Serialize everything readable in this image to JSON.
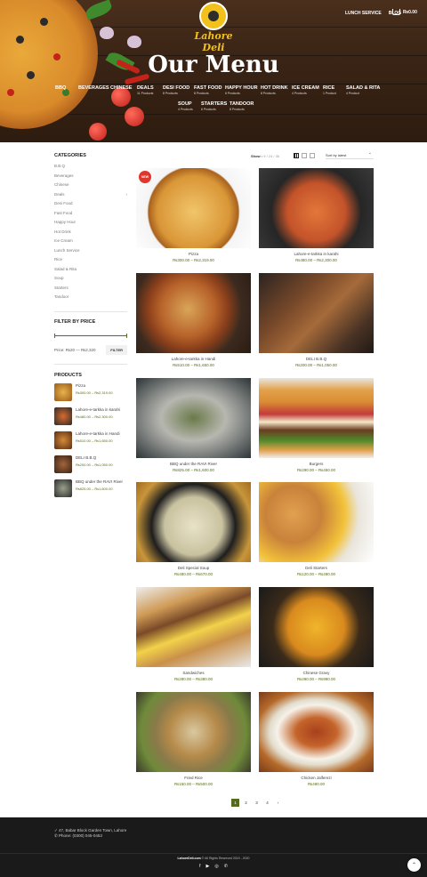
{
  "header": {
    "logo_text": "Lahore Deli",
    "nav": [
      "LUNCH SERVICE",
      "BLOG"
    ],
    "cart_total": "₨0.00",
    "page_title": "Our Menu",
    "categories": [
      {
        "label": "BBQ",
        "count": ""
      },
      {
        "label": "BEVERAGES",
        "count": ""
      },
      {
        "label": "CHINESE",
        "count": ""
      },
      {
        "label": "DEALS",
        "count": "11 Products"
      },
      {
        "label": "DESI FOOD",
        "count": "8 Products"
      },
      {
        "label": "FAST FOOD",
        "count": "8 Products"
      },
      {
        "label": "HAPPY HOUR",
        "count": "6 Products"
      },
      {
        "label": "HOT DRINK",
        "count": "8 Products"
      },
      {
        "label": "ICE CREAM",
        "count": "4 Products"
      },
      {
        "label": "RICE",
        "count": "1 Product"
      },
      {
        "label": "SALAD & RITA",
        "count": "4 Product"
      },
      {
        "label": "SOUP",
        "count": "4 Products"
      },
      {
        "label": "STARTERS",
        "count": "6 Products"
      },
      {
        "label": "TANDOOR",
        "count": "8 Products"
      }
    ]
  },
  "sidebar": {
    "categories_title": "CATEGORIES",
    "categories": [
      "B.B.Q",
      "Beverages",
      "Chinese",
      "Deals",
      "Desi Food",
      "Fast Food",
      "Happy Hour",
      "Hot Drink",
      "Ice Cream",
      "Lunch Service",
      "Rice",
      "Salad & Rita",
      "Soup",
      "Starters",
      "Tandoor"
    ],
    "deals_toggle": "›",
    "filter_title": "FILTER BY PRICE",
    "price_range": "Price: ₨20 — ₨2,320",
    "filter_button": "FILTER",
    "products_title": "PRODUCTS",
    "products": [
      {
        "name": "Pizza",
        "price": "₨300.00 – ₨2,319.00",
        "color": "#c98a2b"
      },
      {
        "name": "Lahore-e-tarkka in karahi",
        "price": "₨480.00 – ₨2,300.00",
        "color": "#b2431e"
      },
      {
        "name": "Lahore-e-tarkka in Handi",
        "price": "₨510.00 – ₨1,650.00",
        "color": "#a4541f"
      },
      {
        "name": "DELI B.B.Q",
        "price": "₨200.00 – ₨1,050.00",
        "color": "#7a4a2a"
      },
      {
        "name": "BBQ under the RAVI River",
        "price": "₨825.00 – ₨1,600.00",
        "color": "#5c6a4a"
      }
    ]
  },
  "toolbar": {
    "show_label": "Show :",
    "show_options": "9 / 24 / 36",
    "sort_label": "Sort by latest"
  },
  "products": [
    {
      "name": "Pizza",
      "price": "₨300.00 – ₨2,319.00",
      "badge": "NEW"
    },
    {
      "name": "Lahore-e-tarkka in karahi",
      "price": "₨480.00 – ₨2,300.00"
    },
    {
      "name": "Lahore-e-tarkka in Handi",
      "price": "₨510.00 – ₨1,650.00"
    },
    {
      "name": "DELI B.B.Q",
      "price": "₨200.00 – ₨1,050.00"
    },
    {
      "name": "BBQ under the RAVI River",
      "price": "₨825.00 – ₨1,600.00"
    },
    {
      "name": "Burgers",
      "price": "₨290.00 – ₨450.00"
    },
    {
      "name": "Deli Special Soup",
      "price": "₨480.00 – ₨670.00"
    },
    {
      "name": "Deli Starters",
      "price": "₨120.00 – ₨480.00"
    },
    {
      "name": "Sandwiches",
      "price": "₨280.00 – ₨380.00"
    },
    {
      "name": "Chinese Gravy",
      "price": "₨490.00 – ₨990.00"
    },
    {
      "name": "Fried Rice",
      "price": "₨150.00 – ₨500.00"
    },
    {
      "name": "Chicken Jalferezi",
      "price": "₨490.00"
    }
  ],
  "pagination": [
    "1",
    "2",
    "3",
    "4",
    "›"
  ],
  "footer": {
    "address": "47, Babar Block Garden Town, Lahore",
    "phone": "Phone: (0300) 045-0453",
    "copyright_site": "LahoreDeli.com",
    "copyright_text": "© All Rights Reserved 2019 - 2020",
    "social": [
      "f",
      "▶",
      "◎",
      "✆"
    ]
  },
  "colors": {
    "accent": "#556b1f",
    "badge": "#e0362c",
    "logo": "#f3c11b"
  }
}
